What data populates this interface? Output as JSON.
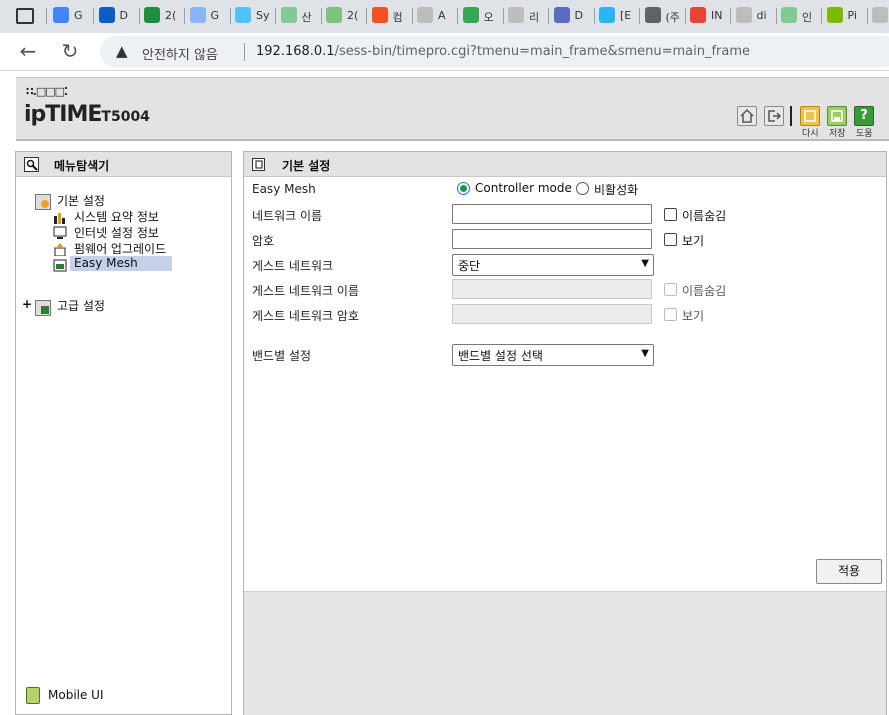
{
  "browser": {
    "tabs": [
      {
        "label": "G",
        "icon": "calendar-24-icon",
        "color": "#4285f4"
      },
      {
        "label": "D",
        "icon": "dsm-icon",
        "color": "#0a5dc2"
      },
      {
        "label": "2(",
        "icon": "plus-green-icon",
        "color": "#1e8e3e"
      },
      {
        "label": "G",
        "icon": "calendar-24-icon",
        "color": "#8ab4f8"
      },
      {
        "label": "Sy",
        "icon": "d-logo-icon",
        "color": "#4fc3f7"
      },
      {
        "label": "산",
        "icon": "sheet-icon",
        "color": "#81c995"
      },
      {
        "label": "2(",
        "icon": "plus-green-icon",
        "color": "#7cc47f"
      },
      {
        "label": "컴",
        "icon": "windows-icon",
        "color": "#f25022"
      },
      {
        "label": "A",
        "icon": "google-icon",
        "color": "#bdbdbd"
      },
      {
        "label": "오",
        "icon": "chat-icon",
        "color": "#34a853"
      },
      {
        "label": "리",
        "icon": "google-icon",
        "color": "#bdbdbd"
      },
      {
        "label": "D",
        "icon": "ring-icon",
        "color": "#5c6bc0"
      },
      {
        "label": "[E",
        "icon": "link-icon",
        "color": "#29b6f6"
      },
      {
        "label": "(주",
        "icon": "window-icon",
        "color": "#5f6368"
      },
      {
        "label": "IN",
        "icon": "map-pin-icon",
        "color": "#ea4335"
      },
      {
        "label": "di",
        "icon": "google-icon",
        "color": "#bdbdbd"
      },
      {
        "label": "인",
        "icon": "chat-icon",
        "color": "#81c995"
      },
      {
        "label": "Pi",
        "icon": "windows-icon",
        "color": "#7fba00"
      },
      {
        "label": "",
        "icon": "google-icon",
        "color": "#bdbdbd"
      }
    ],
    "insecure_label": "안전하지 않음",
    "url_host": "192.168.0.1",
    "url_path": "/sess-bin/timepro.cgi?tmenu=main_frame&smenu=main_frame"
  },
  "header": {
    "logo_top": "∷.□□□⁚",
    "logo_main": "ipTIME",
    "logo_model": "T5004",
    "buttons": {
      "again": "다시",
      "save": "저장",
      "help": "도움"
    }
  },
  "menu": {
    "title": "메뉴탐색기",
    "basic": "기본 설정",
    "items": [
      "시스템 요약 정보",
      "인터넷 설정 정보",
      "펌웨어 업그레이드",
      "Easy Mesh"
    ],
    "advanced_toggle": "+",
    "advanced": "고급 설정",
    "mobile": "Mobile UI"
  },
  "main": {
    "title": "기본 설정",
    "easy_mesh_label": "Easy Mesh",
    "mode_controller": "Controller mode",
    "mode_disabled": "비활성화",
    "network_name_label": "네트워크 이름",
    "hide_name": "이름숨김",
    "password_label": "암호",
    "show_password": "보기",
    "guest_label": "게스트 네트워크",
    "guest_value": "중단",
    "guest_name_label": "게스트 네트워크 이름",
    "guest_hide_name": "이름숨김",
    "guest_password_label": "게스트 네트워크 암호",
    "guest_show": "보기",
    "band_label": "밴드별 설정",
    "band_value": "밴드별 설정 선택",
    "apply": "적용"
  }
}
